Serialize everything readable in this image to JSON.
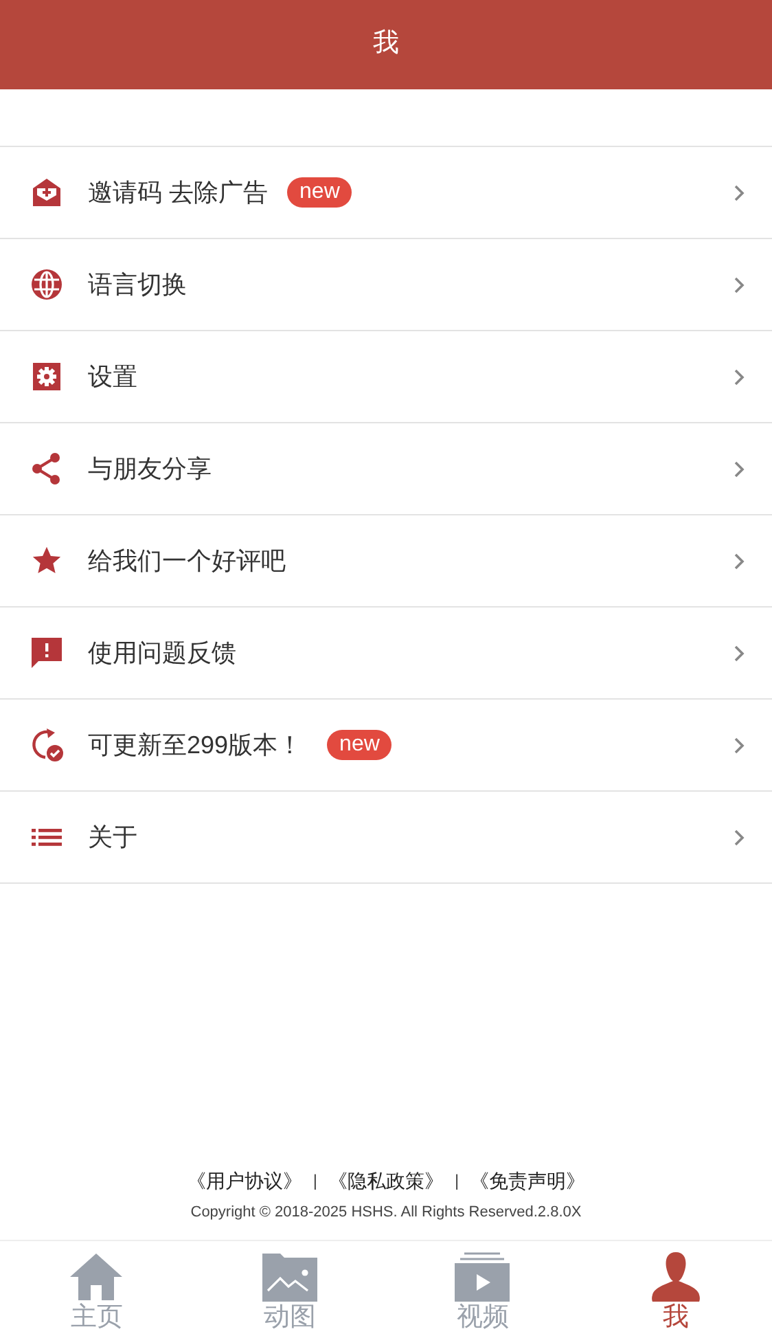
{
  "header": {
    "title": "我"
  },
  "menu": [
    {
      "label": "邀请码 去除广告",
      "badge": "new"
    },
    {
      "label": "语言切换"
    },
    {
      "label": "设置"
    },
    {
      "label": "与朋友分享"
    },
    {
      "label": "给我们一个好评吧"
    },
    {
      "label": "使用问题反馈"
    },
    {
      "label": "可更新至299版本！",
      "badge": "new"
    },
    {
      "label": "关于"
    }
  ],
  "footer": {
    "links": [
      "《用户协议》",
      "《隐私政策》",
      "《免责声明》"
    ],
    "separator": "|",
    "copyright": "Copyright © 2018-2025 HSHS. All Rights Reserved.2.8.0X"
  },
  "tabs": [
    {
      "label": "主页",
      "selected": false
    },
    {
      "label": "动图",
      "selected": false
    },
    {
      "label": "视频",
      "selected": false
    },
    {
      "label": "我",
      "selected": true
    }
  ]
}
